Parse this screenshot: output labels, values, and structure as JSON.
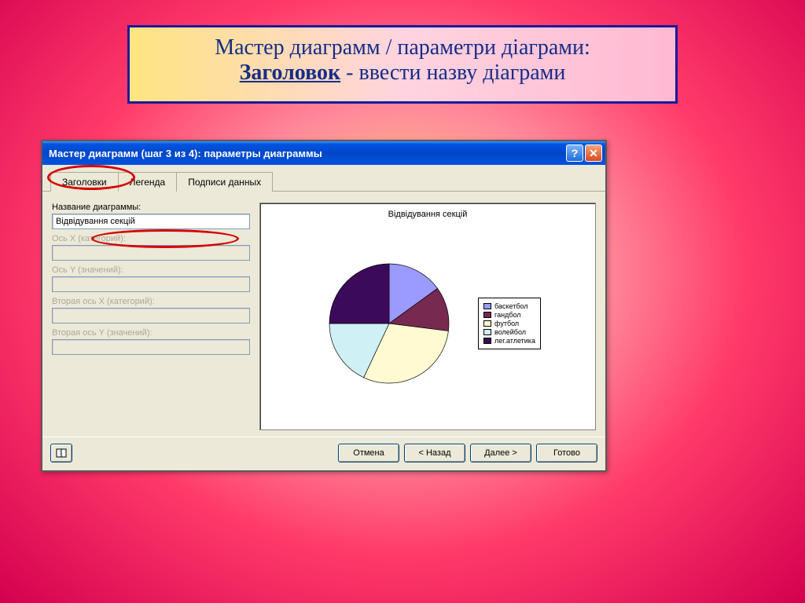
{
  "banner": {
    "line1": "Мастер диаграмм / параметри діаграми:",
    "underlined": "Заголовок",
    "line2_rest": " - ввести назву діаграми"
  },
  "titlebar": "Мастер диаграмм (шаг 3 из 4): параметры диаграммы",
  "tabs": {
    "headers": "Заголовки",
    "legend": "Легенда",
    "datalabels": "Подписи данных"
  },
  "form": {
    "chart_title_label": "Название диаграммы:",
    "chart_title_value": "Відвідування секцій",
    "axis_x_label": "Ось X (категорий):",
    "axis_y_label": "Ось Y (значений):",
    "axis_x2_label": "Вторая ось X (категорий):",
    "axis_y2_label": "Вторая ось Y (значений):"
  },
  "preview_title": "Відвідування секцій",
  "legend": {
    "items": [
      "баскетбол",
      "гандбол",
      "футбол",
      "волейбол",
      "лег.атлетика"
    ]
  },
  "buttons": {
    "help": "?",
    "cancel": "Отмена",
    "back": "< Назад",
    "next": "Далее >",
    "finish": "Готово"
  },
  "chart_data": {
    "type": "pie",
    "title": "Відвідування секцій",
    "categories": [
      "баскетбол",
      "гандбол",
      "футбол",
      "волейбол",
      "лег.атлетика"
    ],
    "values": [
      15,
      12,
      30,
      18,
      25
    ],
    "colors": [
      "#9a9aff",
      "#772950",
      "#fffad1",
      "#cff0f5",
      "#3c0a5a"
    ]
  }
}
